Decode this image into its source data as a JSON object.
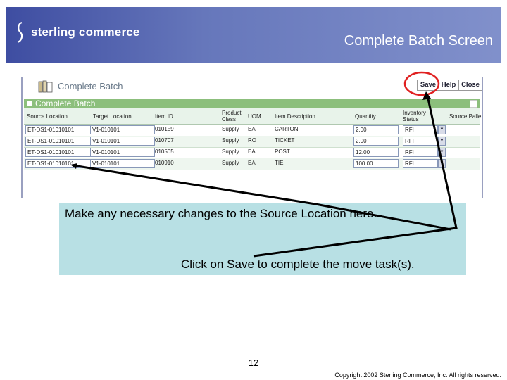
{
  "banner": {
    "brand": "sterling commerce",
    "title": "Complete Batch Screen"
  },
  "app": {
    "header_title": "Complete Batch",
    "buttons": {
      "save": "Save",
      "help": "Help",
      "close": "Close"
    },
    "panel_title": "Complete Batch",
    "columns": [
      "Source Location",
      "Target Location",
      "Item ID",
      "Product Class",
      "UOM",
      "Item Description",
      "Quantity",
      "Inventory Status",
      "Source Pallet"
    ],
    "rows": [
      {
        "source": "ET-DS1-01010101",
        "target": "V1-010101",
        "item": "010159",
        "class": "Supply",
        "uom": "EA",
        "desc": "CARTON",
        "qty": "2.00",
        "status": "RFI"
      },
      {
        "source": "ET-DS1-01010101",
        "target": "V1-010101",
        "item": "010707",
        "class": "Supply",
        "uom": "RO",
        "desc": "TICKET",
        "qty": "2.00",
        "status": "RFI"
      },
      {
        "source": "ET-DS1-01010101",
        "target": "V1-010101",
        "item": "010505",
        "class": "Supply",
        "uom": "EA",
        "desc": "POST",
        "qty": "12.00",
        "status": "RFI"
      },
      {
        "source": "ET-DS1-01010101",
        "target": "V1-010101",
        "item": "010910",
        "class": "Supply",
        "uom": "EA",
        "desc": "TIE",
        "qty": "100.00",
        "status": "RFI"
      }
    ]
  },
  "callout": {
    "line1": "Make any necessary changes to the Source Location here.",
    "line2": "Click on Save to complete the move task(s)."
  },
  "footer": {
    "page_number": "12",
    "copyright": "Copyright 2002 Sterling Commerce, Inc. All rights reserved."
  },
  "colors": {
    "banner": "#6677bb",
    "panel_bar": "#8cbf7c",
    "callout_bg": "#b8e0e4",
    "highlight_ring": "#e02020"
  }
}
